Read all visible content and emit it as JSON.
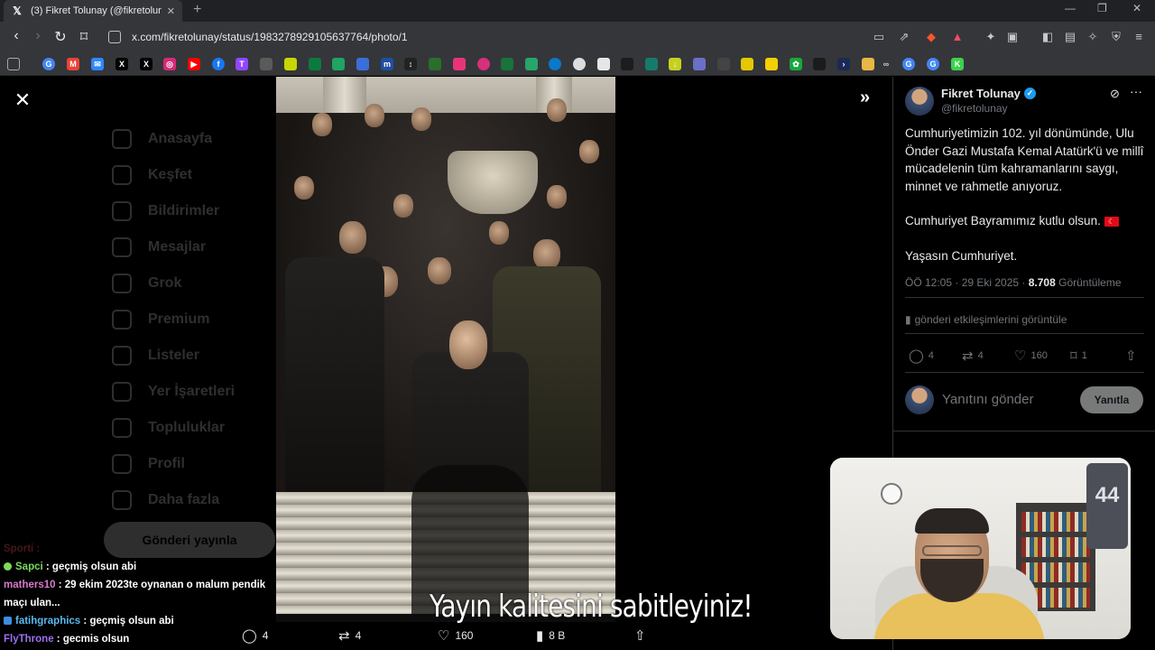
{
  "browser": {
    "tab_title": "(3) Fikret Tolunay (@fikretolunay",
    "tab_close": "✕",
    "new_tab": "+",
    "url": "x.com/fikretolunay/status/1983278929105637764/photo/1"
  },
  "sidebar_bg": {
    "items": [
      "Anasayfa",
      "Keşfet",
      "Bildirimler",
      "Mesajlar",
      "Grok",
      "Premium",
      "Listeler",
      "Yer İşaretleri",
      "Topluluklar",
      "Profil",
      "Daha fazla"
    ],
    "post_button": "Gönderi yayınla"
  },
  "media_actions": {
    "replies": "4",
    "reposts": "4",
    "likes": "160",
    "views": "8 B"
  },
  "tweet": {
    "author_name": "Fikret Tolunay",
    "author_handle": "@fikretolunay",
    "paragraph1": "Cumhuriyetimizin 102. yıl dönümünde, Ulu Önder Gazi Mustafa Kemal Atatürk'ü ve millî mücadelenin tüm kahramanlarını saygı, minnet ve rahmetle anıyoruz.",
    "paragraph2": "Cumhuriyet Bayramımız kutlu olsun.",
    "paragraph3": "Yaşasın Cumhuriyet.",
    "timestamp": "ÖÖ 12:05 · 29 Eki 2025 · ",
    "views_count": "8.708",
    "views_label": "Görüntüleme",
    "engagements_link": "gönderi etkileşimlerini görüntüle",
    "replies": "4",
    "reposts": "4",
    "likes": "160",
    "bookmarks": "1",
    "reply_placeholder": "Yanıtını gönder",
    "reply_button": "Yanıtla"
  },
  "chat": [
    {
      "user": "Sapci",
      "message": "geçmiş olsun abi"
    },
    {
      "user": "mathers10",
      "message": "29 ekim 2023te oynanan o malum pendik maçı ulan..."
    },
    {
      "user": "fatihgraphics",
      "message": "geçmiş olsun abi"
    },
    {
      "user": "FlyThrone",
      "message": "gecmis olsun"
    }
  ],
  "chat_faded_user": "Sporti",
  "overlay_subtitle": "Yayın kalitesini sabitleyiniz!",
  "webcam_jersey_text": "44",
  "colors": {
    "accent": "#1d9bf0",
    "background": "#000000",
    "muted": "#71767b"
  }
}
